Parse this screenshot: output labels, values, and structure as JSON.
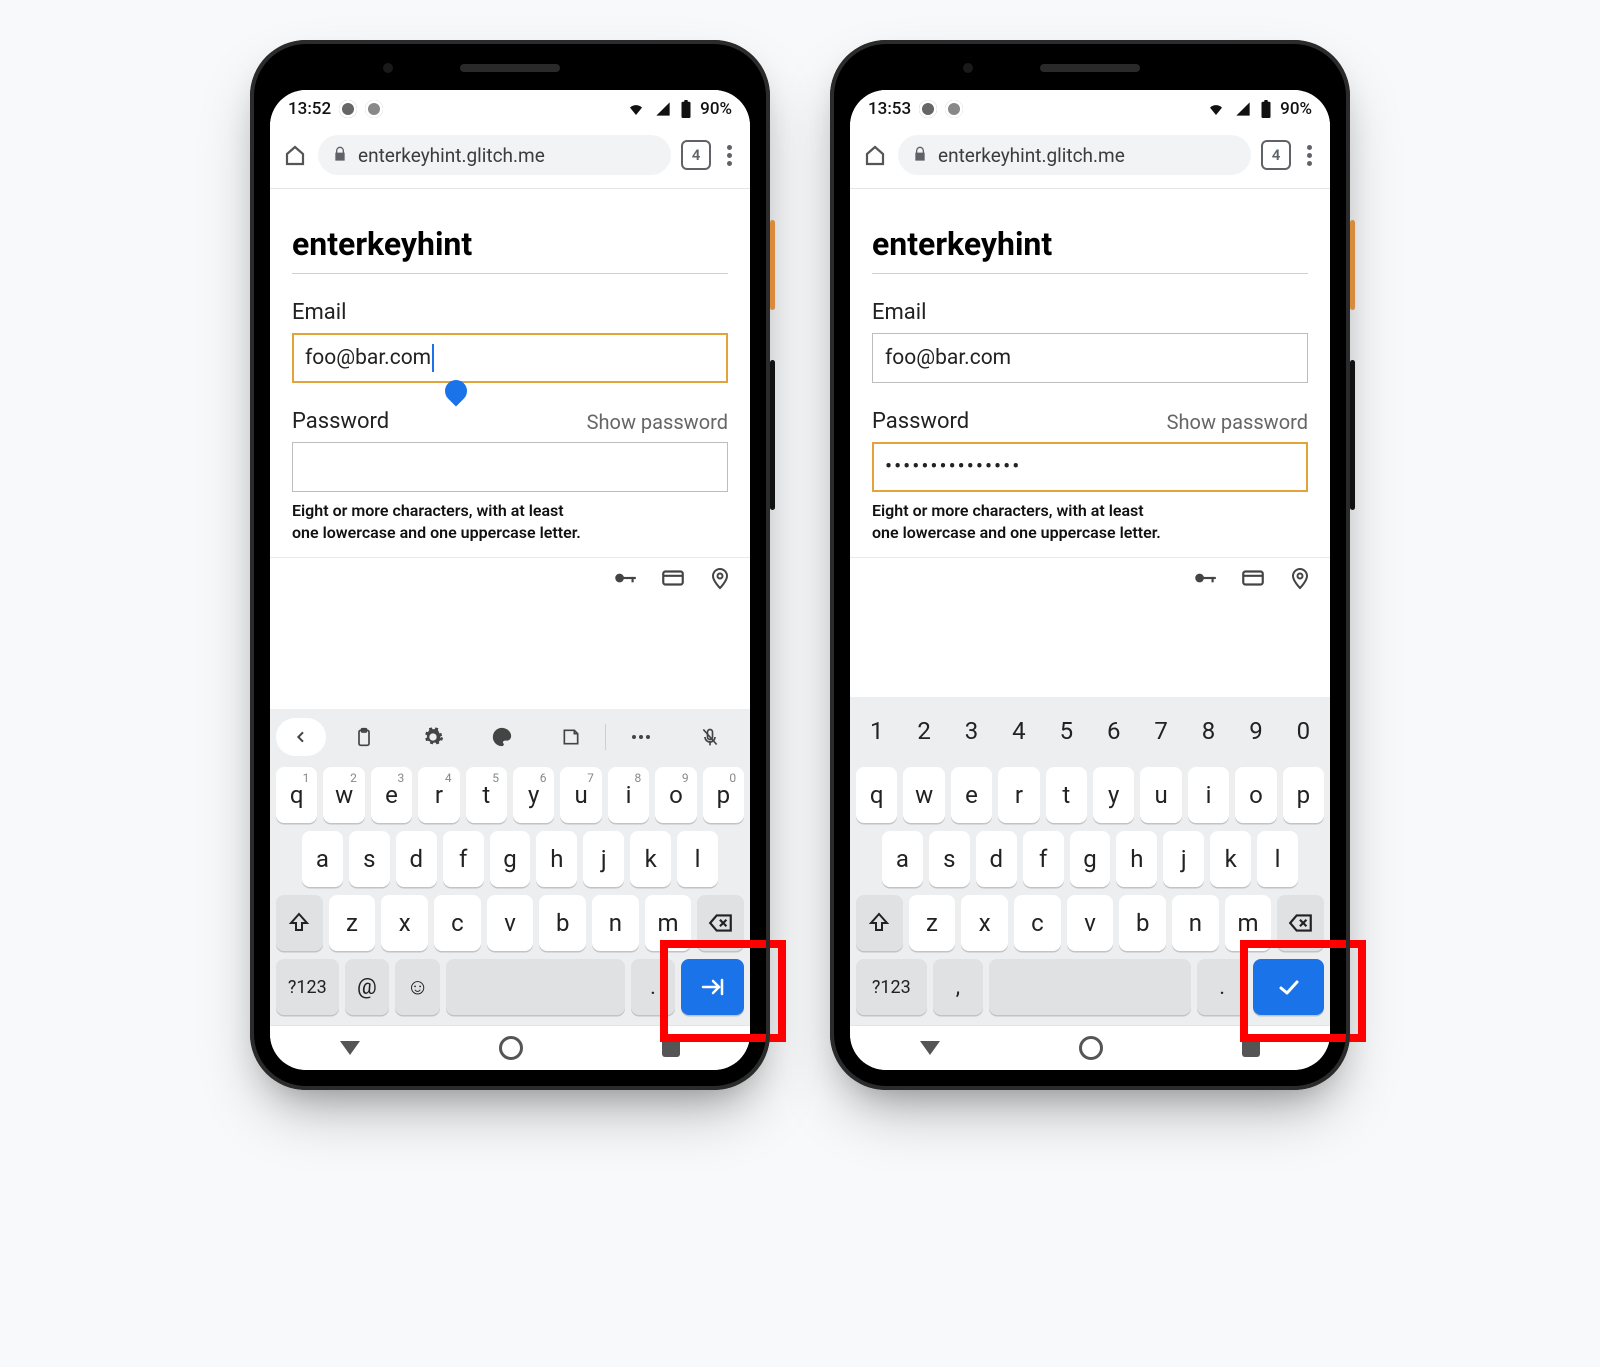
{
  "phones": [
    {
      "status": {
        "time": "13:52",
        "battery": "90%"
      },
      "url": {
        "host": "enterkeyhint.glitch.me",
        "tab_count": "4"
      },
      "page": {
        "title": "enterkeyhint",
        "email_label": "Email",
        "email_value": "foo@bar.com",
        "email_focused": true,
        "password_label": "Password",
        "show_password": "Show password",
        "password_value": "",
        "password_focused": false,
        "hint_line1": "Eight or more characters, with at least",
        "hint_line2": "one lowercase and one uppercase letter."
      },
      "keyboard": {
        "mode": "email",
        "toolbar": true,
        "row1": [
          {
            "k": "q",
            "s": "1"
          },
          {
            "k": "w",
            "s": "2"
          },
          {
            "k": "e",
            "s": "3"
          },
          {
            "k": "r",
            "s": "4"
          },
          {
            "k": "t",
            "s": "5"
          },
          {
            "k": "y",
            "s": "6"
          },
          {
            "k": "u",
            "s": "7"
          },
          {
            "k": "i",
            "s": "8"
          },
          {
            "k": "o",
            "s": "9"
          },
          {
            "k": "p",
            "s": "0"
          }
        ],
        "row2": [
          "a",
          "s",
          "d",
          "f",
          "g",
          "h",
          "j",
          "k",
          "l"
        ],
        "row3": [
          "z",
          "x",
          "c",
          "v",
          "b",
          "n",
          "m"
        ],
        "row4": {
          "sym": "?123",
          "extra1": "@",
          "extra2": "☺",
          "dot": ".",
          "enter": "next"
        }
      }
    },
    {
      "status": {
        "time": "13:53",
        "battery": "90%"
      },
      "url": {
        "host": "enterkeyhint.glitch.me",
        "tab_count": "4"
      },
      "page": {
        "title": "enterkeyhint",
        "email_label": "Email",
        "email_value": "foo@bar.com",
        "email_focused": false,
        "password_label": "Password",
        "show_password": "Show password",
        "password_value": "•••••••••••••••",
        "password_focused": true,
        "hint_line1": "Eight or more characters, with at least",
        "hint_line2": "one lowercase and one uppercase letter."
      },
      "keyboard": {
        "mode": "password",
        "toolbar": false,
        "numrow": [
          "1",
          "2",
          "3",
          "4",
          "5",
          "6",
          "7",
          "8",
          "9",
          "0"
        ],
        "row1": [
          {
            "k": "q"
          },
          {
            "k": "w"
          },
          {
            "k": "e"
          },
          {
            "k": "r"
          },
          {
            "k": "t"
          },
          {
            "k": "y"
          },
          {
            "k": "u"
          },
          {
            "k": "i"
          },
          {
            "k": "o"
          },
          {
            "k": "p"
          }
        ],
        "row2": [
          "a",
          "s",
          "d",
          "f",
          "g",
          "h",
          "j",
          "k",
          "l"
        ],
        "row3": [
          "z",
          "x",
          "c",
          "v",
          "b",
          "n",
          "m"
        ],
        "row4": {
          "sym": "?123",
          "extra1": ",",
          "dot": ".",
          "enter": "done"
        }
      }
    }
  ]
}
